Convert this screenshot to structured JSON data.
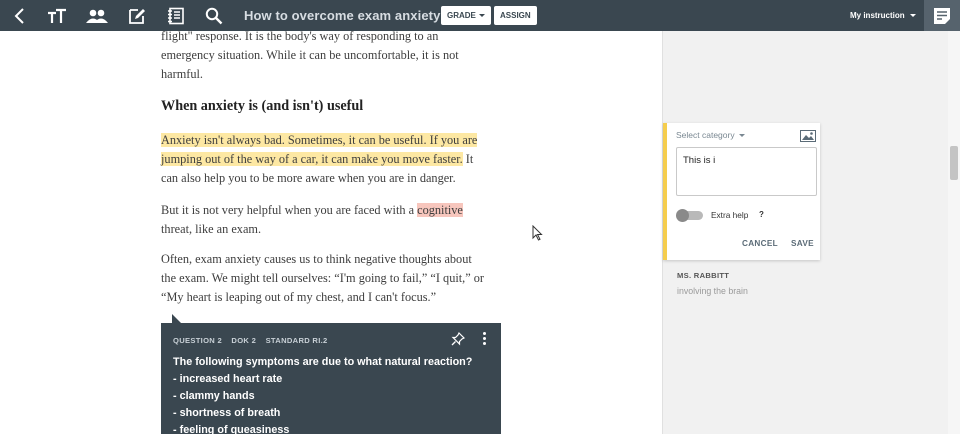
{
  "toolbar": {
    "icons": [
      "back-chevron-icon",
      "text-size-icon",
      "users-icon",
      "edit-icon",
      "notebook-icon",
      "search-icon",
      "notes-panel-icon"
    ],
    "title": "How to overcome exam anxiety",
    "grade_label": "GRADE",
    "assign_label": "ASSIGN",
    "instruction_label": "My instruction",
    "background_color": "#3a4750"
  },
  "article": {
    "intro_line1": "flight\" response. It is the body's way of responding to an",
    "intro_line2": "emergency situation. While it can be uncomfortable, it is not",
    "intro_line3": "harmful.",
    "heading": "When anxiety is (and isn't) useful",
    "p1_highlight_line1": "Anxiety isn't always bad. Sometimes, it can be useful. If you are",
    "p1_highlight_line2": "jumping out of the way of a car, it can make you move faster.",
    "p1_rest_line2": " It",
    "p1_line3": "can also help you to be more aware when you are in danger.",
    "p2_before": "But it is not very helpful when you are faced with a ",
    "p2_highlight": "cognitive",
    "p2_line2": "threat, like an exam.",
    "p3_line1": "Often, exam anxiety causes us to think negative thoughts about",
    "p3_line2": "the exam. We might tell ourselves: “I'm going to fail,” “I quit,” or",
    "p3_line3": "“My heart is leaping out of my chest, and I can't focus.”",
    "highlight_colors": {
      "yellow": "#fde8a3",
      "pink": "#f7c6bd"
    }
  },
  "question": {
    "number": "QUESTION 2",
    "dok": "DOK 2",
    "standard": "STANDARD RI.2",
    "prompt": "The following symptoms are due to what natural reaction?",
    "items": [
      "- increased heart rate",
      "- clammy hands",
      "- shortness of breath",
      "- feeling of queasiness"
    ]
  },
  "note_editor": {
    "category_placeholder": "Select category",
    "input_value": "This is i",
    "extra_help_label": "Extra help",
    "help_symbol": "?",
    "extra_help_on": false,
    "cancel_label": "CANCEL",
    "save_label": "SAVE",
    "accent_color": "#f5cd4d"
  },
  "existing_note": {
    "author": "MS. RABBITT",
    "text": "involving the brain"
  }
}
